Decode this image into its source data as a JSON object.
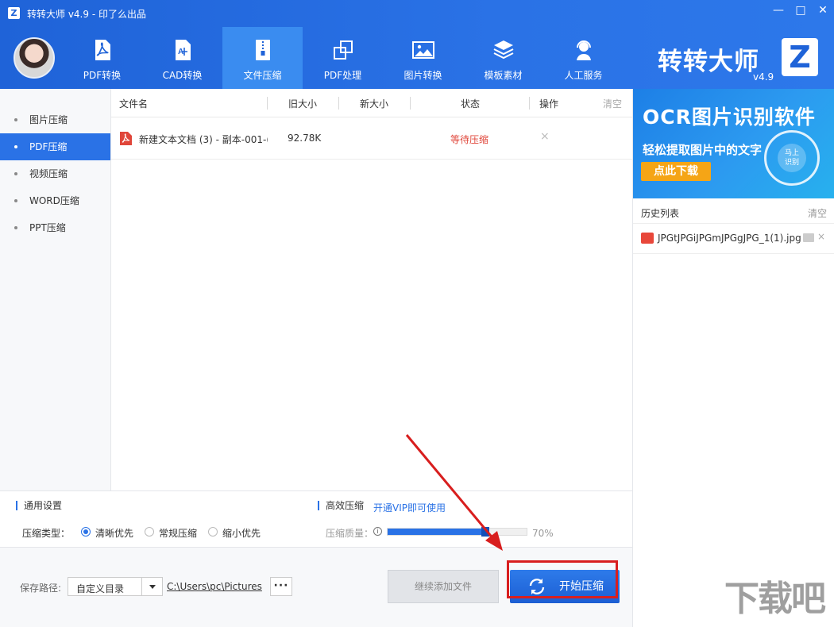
{
  "titlebar": {
    "logo_letter": "Z",
    "title": "转转大师 v4.9 - 印了么出品",
    "minimize_glyph": "—",
    "maximize_glyph": "□",
    "close_glyph": "✕"
  },
  "nav": {
    "items": [
      {
        "label": "PDF转换",
        "icon": "pdf-icon",
        "active": false
      },
      {
        "label": "CAD转换",
        "icon": "cad-icon",
        "active": false
      },
      {
        "label": "文件压缩",
        "icon": "zip-icon",
        "active": true
      },
      {
        "label": "PDF处理",
        "icon": "squares-icon",
        "active": false
      },
      {
        "label": "图片转换",
        "icon": "image-icon",
        "active": false
      },
      {
        "label": "模板素材",
        "icon": "layers-icon",
        "active": false
      },
      {
        "label": "人工服务",
        "icon": "headset-icon",
        "active": false
      }
    ]
  },
  "brand": {
    "name": "转转大师",
    "version": "v4.9",
    "logo_letter": "Z"
  },
  "sidebar": {
    "items": [
      {
        "label": "图片压缩",
        "active": false
      },
      {
        "label": "PDF压缩",
        "active": true
      },
      {
        "label": "视频压缩",
        "active": false
      },
      {
        "label": "WORD压缩",
        "active": false
      },
      {
        "label": "PPT压缩",
        "active": false
      }
    ]
  },
  "table": {
    "headers": {
      "filename": "文件名",
      "old_size": "旧大小",
      "new_size": "新大小",
      "status": "状态",
      "action": "操作",
      "clear": "清空"
    },
    "rows": [
      {
        "filename": "新建文本文档 (3) - 副本-001-(",
        "old_size": "92.78K",
        "new_size": "",
        "status": "等待压缩",
        "status_color": "#e0463a",
        "remove_glyph": "×"
      }
    ]
  },
  "ad": {
    "title": "OCR图片识别软件",
    "subtitle": "轻松提取图片中的文字",
    "button": "点此下载",
    "badge_line1": "马上",
    "badge_line2": "识别"
  },
  "history": {
    "title": "历史列表",
    "clear": "清空",
    "items": [
      {
        "name": "JPGtJPGiJPGmJPGgJPG_1(1).jpg",
        "close_glyph": "×"
      }
    ]
  },
  "settings": {
    "general_title": "通用设置",
    "type_label": "压缩类型：",
    "options": [
      {
        "label": "清晰优先",
        "checked": true
      },
      {
        "label": "常规压缩",
        "checked": false
      },
      {
        "label": "缩小优先",
        "checked": false
      }
    ],
    "hq_title": "高效压缩",
    "vip_link": "开通VIP即可使用",
    "quality_label": "压缩质量：",
    "info_glyph": "i",
    "quality_value": 70,
    "quality_text": "70%"
  },
  "footer": {
    "save_label": "保存路径:",
    "dir_option": "自定义目录",
    "path": "C:\\Users\\pc\\Pictures",
    "more_glyph": "···",
    "add_button": "继续添加文件",
    "start_button": "开始压缩"
  },
  "watermark": {
    "text": "下载吧"
  },
  "colors": {
    "header_blue": "#2a72e6",
    "accent_blue": "#2a72e6",
    "highlight_red": "#d81e1e",
    "ad_button_orange": "#f5a516"
  }
}
